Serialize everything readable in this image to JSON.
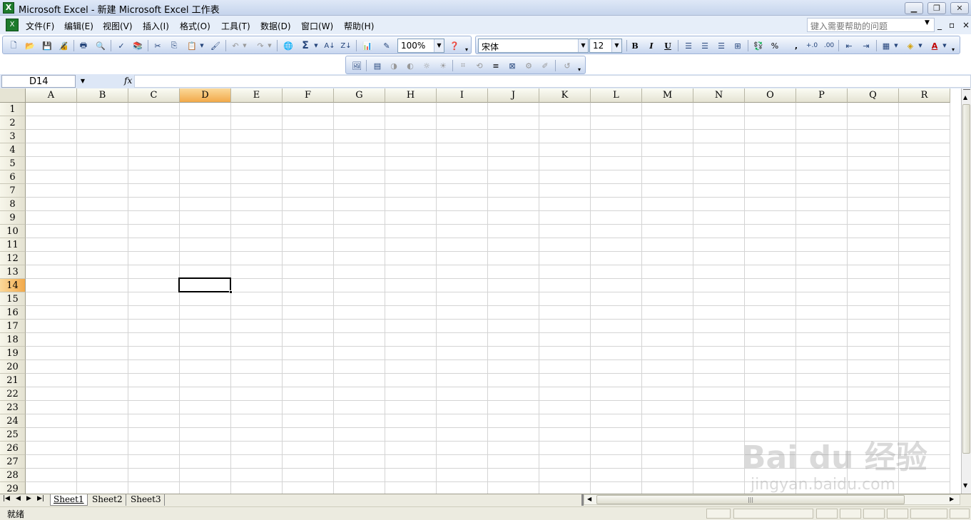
{
  "window": {
    "title": "Microsoft Excel - 新建 Microsoft Excel 工作表",
    "app_icon": "excel-icon",
    "controls": [
      "minimize-icon",
      "restore-icon",
      "close-icon"
    ]
  },
  "menu": {
    "items": [
      "文件(F)",
      "编辑(E)",
      "视图(V)",
      "插入(I)",
      "格式(O)",
      "工具(T)",
      "数据(D)",
      "窗口(W)",
      "帮助(H)"
    ],
    "help_placeholder": "键入需要帮助的问题",
    "mdi_controls": [
      "_",
      "▫",
      "×"
    ]
  },
  "toolbar": {
    "zoom": "100%",
    "font_name": "宋体",
    "font_size": "12",
    "bold": "B",
    "italic": "I",
    "underline": "U",
    "percent": "%",
    "comma": ",",
    "sum": "Σ",
    "font_color_letter": "A"
  },
  "formula_bar": {
    "name_box": "D14",
    "fx": "fx",
    "content": ""
  },
  "grid": {
    "columns": [
      "A",
      "B",
      "C",
      "D",
      "E",
      "F",
      "G",
      "H",
      "I",
      "J",
      "K",
      "L",
      "M",
      "N",
      "O",
      "P",
      "Q",
      "R"
    ],
    "rows": [
      "1",
      "2",
      "3",
      "4",
      "5",
      "6",
      "7",
      "8",
      "9",
      "10",
      "11",
      "12",
      "13",
      "14",
      "15",
      "16",
      "17",
      "18",
      "19",
      "20",
      "21",
      "22",
      "23",
      "24",
      "25",
      "26",
      "27",
      "28",
      "29"
    ],
    "active_cell": "D14",
    "selected_column": "D",
    "selected_row": "14"
  },
  "sheets": {
    "tabs": [
      "Sheet1",
      "Sheet2",
      "Sheet3"
    ],
    "active": "Sheet1"
  },
  "status": {
    "text": "就绪"
  },
  "watermark": {
    "brand": "Bai du 经验",
    "url": "jingyan.baidu.com"
  }
}
